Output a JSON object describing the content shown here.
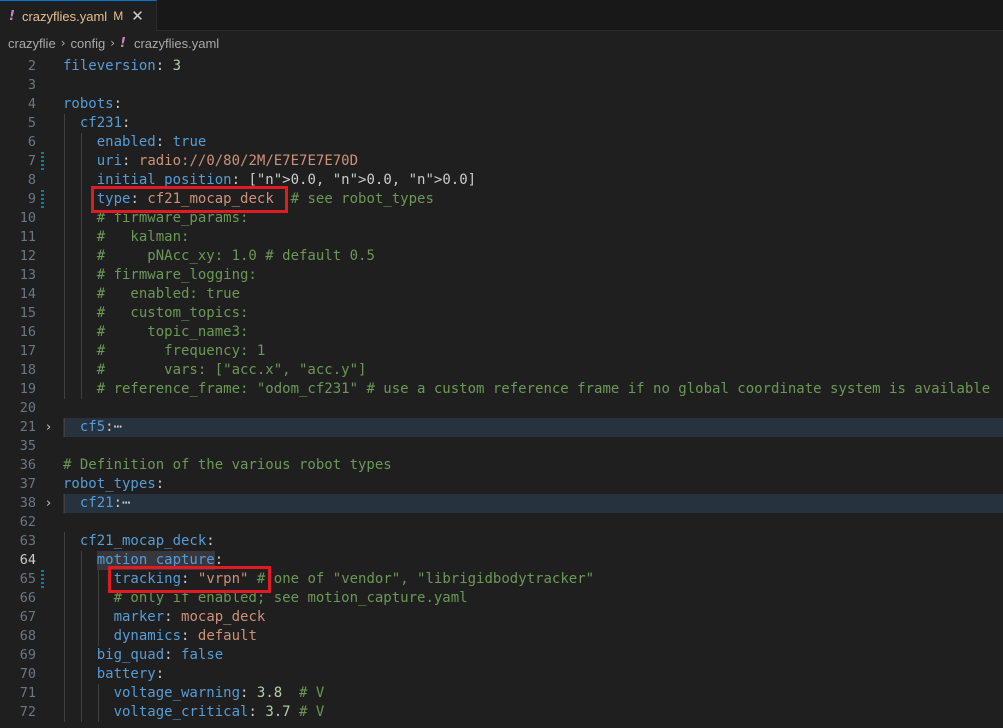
{
  "tab": {
    "warn_icon": "!",
    "filename": "crazyflies.yaml",
    "status": "M",
    "close": "✕"
  },
  "breadcrumb": {
    "items": [
      "crazyflie",
      "config",
      "crazyflies.yaml"
    ],
    "separator": "›",
    "file_icon": "!"
  },
  "lines": [
    {
      "num": "2",
      "text": "fileversion: 3"
    },
    {
      "num": "3",
      "text": ""
    },
    {
      "num": "4",
      "text": "robots:"
    },
    {
      "num": "5",
      "text": "  cf231:"
    },
    {
      "num": "6",
      "text": "    enabled: true"
    },
    {
      "num": "7",
      "text": "    uri: radio://0/80/2M/E7E7E7E70D"
    },
    {
      "num": "8",
      "text": "    initial_position: [0.0, 0.0, 0.0]"
    },
    {
      "num": "9",
      "text": "    type: cf21_mocap_deck  # see robot_types"
    },
    {
      "num": "10",
      "text": "    # firmware_params:"
    },
    {
      "num": "11",
      "text": "    #   kalman:"
    },
    {
      "num": "12",
      "text": "    #     pNAcc_xy: 1.0 # default 0.5"
    },
    {
      "num": "13",
      "text": "    # firmware_logging:"
    },
    {
      "num": "14",
      "text": "    #   enabled: true"
    },
    {
      "num": "15",
      "text": "    #   custom_topics:"
    },
    {
      "num": "16",
      "text": "    #     topic_name3:"
    },
    {
      "num": "17",
      "text": "    #       frequency: 1"
    },
    {
      "num": "18",
      "text": "    #       vars: [\"acc.x\", \"acc.y\"]"
    },
    {
      "num": "19",
      "text": "    # reference_frame: \"odom_cf231\" # use a custom reference frame if no global coordinate system is available"
    },
    {
      "num": "20",
      "text": ""
    },
    {
      "num": "21",
      "text": "  cf5:⋯"
    },
    {
      "num": "35",
      "text": ""
    },
    {
      "num": "36",
      "text": "# Definition of the various robot types"
    },
    {
      "num": "37",
      "text": "robot_types:"
    },
    {
      "num": "38",
      "text": "  cf21:⋯"
    },
    {
      "num": "62",
      "text": ""
    },
    {
      "num": "63",
      "text": "  cf21_mocap_deck:"
    },
    {
      "num": "64",
      "text": "    motion_capture:"
    },
    {
      "num": "65",
      "text": "      tracking: \"vrpn\" # one of \"vendor\", \"librigidbodytracker\""
    },
    {
      "num": "66",
      "text": "      # only if enabled; see motion_capture.yaml"
    },
    {
      "num": "67",
      "text": "      marker: mocap_deck"
    },
    {
      "num": "68",
      "text": "      dynamics: default"
    },
    {
      "num": "69",
      "text": "    big_quad: false"
    },
    {
      "num": "70",
      "text": "    battery:"
    },
    {
      "num": "71",
      "text": "      voltage_warning: 3.8  # V"
    },
    {
      "num": "72",
      "text": "      voltage_critical: 3.7 # V"
    }
  ],
  "active_line": "64",
  "modified_lines": [
    "7",
    "9",
    "65"
  ],
  "folded_lines": [
    "21",
    "38"
  ],
  "colors": {
    "key": "#569cd6",
    "string": "#ce9178",
    "number": "#b5cea8",
    "comment": "#6a9955",
    "highlight_box": "#e01b24"
  }
}
